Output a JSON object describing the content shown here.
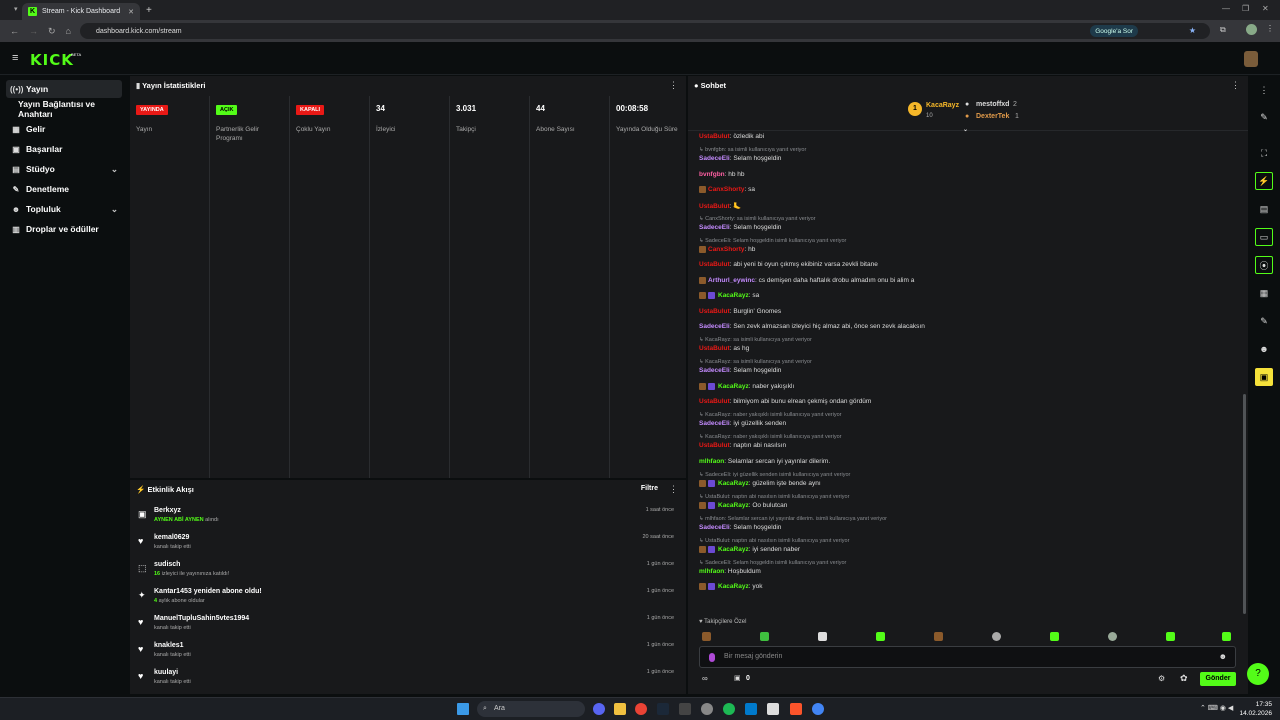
{
  "browser": {
    "tab_title": "Stream - Kick Dashboard",
    "url": "dashboard.kick.com/stream",
    "google_btn": "Google'a Sor"
  },
  "header": {
    "logo": "KICK",
    "beta": "BETA"
  },
  "sidebar": {
    "items": [
      {
        "label": "Yayın",
        "icon": "broadcast-icon"
      },
      {
        "label": "Yayın Bağlantısı ve Anahtarı",
        "icon": ""
      },
      {
        "label": "Gelir",
        "icon": "bank-icon"
      },
      {
        "label": "Başarılar",
        "icon": "trophy-icon"
      },
      {
        "label": "Stüdyo",
        "icon": "film-icon"
      },
      {
        "label": "Denetleme",
        "icon": "wrench-icon"
      },
      {
        "label": "Topluluk",
        "icon": "users-icon"
      },
      {
        "label": "Droplar ve ödüller",
        "icon": "gift-icon"
      }
    ]
  },
  "stats": {
    "title": "Yayın İstatistikleri",
    "cols": [
      {
        "value": "YAYINDA",
        "label": "Yayın",
        "kind": "red"
      },
      {
        "value": "AÇIK",
        "label": "Partnerlik Gelir Programı",
        "kind": "green"
      },
      {
        "value": "KAPALI",
        "label": "Çoklu Yayın",
        "kind": "red"
      },
      {
        "value": "34",
        "label": "İzleyici",
        "kind": "num"
      },
      {
        "value": "3.031",
        "label": "Takipçi",
        "kind": "num"
      },
      {
        "value": "44",
        "label": "Abone Sayısı",
        "kind": "num"
      },
      {
        "value": "00:08:58",
        "label": "Yayında Olduğu Süre",
        "kind": "num"
      }
    ]
  },
  "activity": {
    "title": "Etkinlik Akışı",
    "filter": "Filtre",
    "items": [
      {
        "name": "Berkxyz",
        "desc_b": "AYNEN ABİ AYNEN",
        "desc": " alındı",
        "time": "1 saat önce",
        "icon": "gift-icon"
      },
      {
        "name": "kemal0629",
        "desc_b": "",
        "desc": "kanalı takip etti",
        "time": "20 saat önce",
        "icon": "heart-icon"
      },
      {
        "name": "sudisch",
        "desc_b": "16",
        "desc": " izleyici ile yayınınıza katıldı!",
        "time": "1 gün önce",
        "icon": "raid-icon"
      },
      {
        "name": "Kantar1453 yeniden abone oldu!",
        "desc_b": "4",
        "desc": " aylık abone oldular",
        "time": "1 gün önce",
        "icon": "star-icon"
      },
      {
        "name": "ManuelTupluSahin5vtes1994",
        "desc_b": "",
        "desc": "kanalı takip etti",
        "time": "1 gün önce",
        "icon": "heart-icon"
      },
      {
        "name": "knakles1",
        "desc_b": "",
        "desc": "kanalı takip etti",
        "time": "1 gün önce",
        "icon": "heart-icon"
      },
      {
        "name": "kuulayi",
        "desc_b": "",
        "desc": "kanalı takip etti",
        "time": "1 gün önce",
        "icon": "heart-icon"
      }
    ]
  },
  "chat": {
    "title": "Sohbet",
    "top": {
      "first": "KacaRayz",
      "first_count": "10",
      "second": "mestoffxd",
      "second_count": "2",
      "third": "DexterTek",
      "third_count": "1"
    },
    "lines": [
      {
        "type": "msg",
        "user": "UstaBulut",
        "color": "#e91916",
        "text": ": özledik abi"
      },
      {
        "type": "reply",
        "text": "↳ bvnfgbn: sa isimli kullanıcıya yanıt veriyor"
      },
      {
        "type": "msg",
        "user": "SadeceEli",
        "color": "#c48bff",
        "text": ": Selam hoşgeldin"
      },
      {
        "type": "msg",
        "user": "bvnfgbn",
        "color": "#ff5fa2",
        "text": ": hb hb"
      },
      {
        "type": "msg",
        "user": "CanxShorty",
        "color": "#e91916",
        "text": ": sa",
        "emote": true
      },
      {
        "type": "msg",
        "user": "UstaBulut",
        "color": "#e91916",
        "text": ": 🦶"
      },
      {
        "type": "reply",
        "text": "↳ CanxShorty: sa isimli kullanıcıya yanıt veriyor"
      },
      {
        "type": "msg",
        "user": "SadeceEli",
        "color": "#c48bff",
        "text": ": Selam hoşgeldin"
      },
      {
        "type": "reply",
        "text": "↳ SadeceEli: Selam hoşgeldin isimli kullanıcıya yanıt veriyor"
      },
      {
        "type": "msg",
        "user": "CanxShorty",
        "color": "#e91916",
        "text": ": hb",
        "emote": true
      },
      {
        "type": "msg",
        "user": "UstaBulut",
        "color": "#e91916",
        "text": ": abi yeni bi oyun çıkmış ekibiniz varsa zevkli bitane"
      },
      {
        "type": "msg",
        "user": "Arthurl_eywinc",
        "color": "#c48bff",
        "text": ": cs demişen daha haftalık drobu almadım onu bi alim a",
        "emote": true
      },
      {
        "type": "msg",
        "user": "KacaRayz",
        "color": "#53fc18",
        "text": ": sa",
        "emote": true,
        "sub": true
      },
      {
        "type": "msg",
        "user": "UstaBulut",
        "color": "#e91916",
        "text": ": Burglin' Gnomes"
      },
      {
        "type": "msg",
        "user": "SadeceEli",
        "color": "#c48bff",
        "text": ": Sen zevk almazsan izleyici hiç almaz abi, önce sen zevk alacaksın"
      },
      {
        "type": "reply",
        "text": "↳ KacaRayz: sa isimli kullanıcıya yanıt veriyor"
      },
      {
        "type": "msg",
        "user": "UstaBulut",
        "color": "#e91916",
        "text": ": as hg"
      },
      {
        "type": "reply",
        "text": "↳ KacaRayz: sa isimli kullanıcıya yanıt veriyor"
      },
      {
        "type": "msg",
        "user": "SadeceEli",
        "color": "#c48bff",
        "text": ": Selam hoşgeldin"
      },
      {
        "type": "msg",
        "user": "KacaRayz",
        "color": "#53fc18",
        "text": ": naber yakışıklı",
        "emote": true,
        "sub": true
      },
      {
        "type": "msg",
        "user": "UstaBulut",
        "color": "#e91916",
        "text": ": bilmiyom abi bunu elrean çekmiş ondan gördüm"
      },
      {
        "type": "reply",
        "text": "↳ KacaRayz: naber yakışıklı isimli kullanıcıya yanıt veriyor"
      },
      {
        "type": "msg",
        "user": "SadeceEli",
        "color": "#c48bff",
        "text": ": iyi güzellik senden"
      },
      {
        "type": "reply",
        "text": "↳ KacaRayz: naber yakışıklı isimli kullanıcıya yanıt veriyor"
      },
      {
        "type": "msg",
        "user": "UstaBulut",
        "color": "#e91916",
        "text": ": naptın abi nasılsın"
      },
      {
        "type": "msg",
        "user": "mlhfaon",
        "color": "#53fc18",
        "text": ": Selamlar sercan iyi yayınlar dilerim."
      },
      {
        "type": "reply",
        "text": "↳ SadeceEli: iyi güzellik senden isimli kullanıcıya yanıt veriyor"
      },
      {
        "type": "msg",
        "user": "KacaRayz",
        "color": "#53fc18",
        "text": ": güzelim işte bende aynı",
        "emote": true,
        "sub": true
      },
      {
        "type": "reply",
        "text": "↳ UstaBulut: naptın abi nasılsın isimli kullanıcıya yanıt veriyor"
      },
      {
        "type": "msg",
        "user": "KacaRayz",
        "color": "#53fc18",
        "text": ": Oo bulutcan",
        "emote": true,
        "sub": true
      },
      {
        "type": "reply",
        "text": "↳ mlhfaon: Selamlar sercan iyi yayınlar dilerim. isimli kullanıcıya yanıt veriyor"
      },
      {
        "type": "msg",
        "user": "SadeceEli",
        "color": "#c48bff",
        "text": ": Selam hoşgeldin"
      },
      {
        "type": "reply",
        "text": "↳ UstaBulut: naptın abi nasılsın isimli kullanıcıya yanıt veriyor"
      },
      {
        "type": "msg",
        "user": "KacaRayz",
        "color": "#53fc18",
        "text": ": iyi senden naber",
        "emote": true,
        "sub": true
      },
      {
        "type": "reply",
        "text": "↳ SadeceEli: Selam hoşgeldin isimli kullanıcıya yanıt veriyor"
      },
      {
        "type": "msg",
        "user": "mlhfaon",
        "color": "#53fc18",
        "text": ": Hoşbuldum"
      },
      {
        "type": "msg",
        "user": "KacaRayz",
        "color": "#53fc18",
        "text": ": yok",
        "emote": true,
        "sub": true
      }
    ],
    "followers_only": "Takipçilere Özel",
    "placeholder": "Bir mesaj gönderin",
    "points": "0",
    "send": "Gönder"
  },
  "taskbar": {
    "search": "Ara",
    "time": "17:35",
    "date": "14.02.2026"
  },
  "colors": {
    "accent": "#53fc18",
    "live": "#e91916"
  }
}
